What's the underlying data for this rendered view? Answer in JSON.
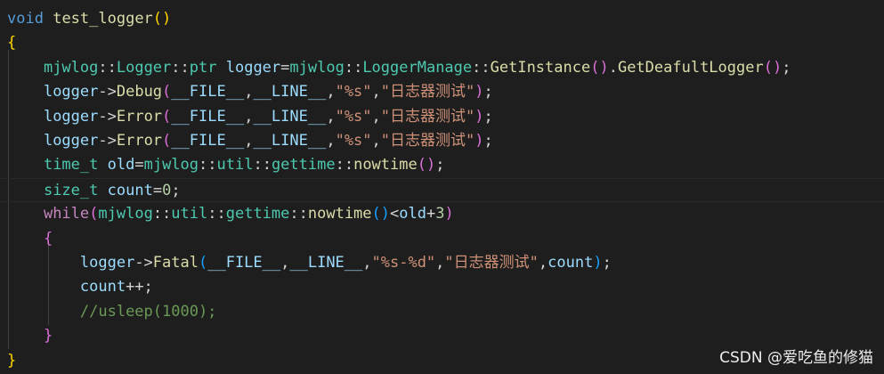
{
  "editor": {
    "colors": {
      "background": "#1e1e1e",
      "keyword": "#569cd6",
      "function": "#dcdcaa",
      "type": "#4ec9b0",
      "variable": "#9cdcfe",
      "string": "#ce9178",
      "number": "#b5cea8",
      "comment": "#6a9955",
      "control": "#c586c0",
      "bracket1": "#ffd700",
      "bracket2": "#da70d6",
      "bracket3": "#179fff",
      "default": "#d4d4d4"
    },
    "lines": [
      [
        [
          "void",
          "keyword"
        ],
        [
          " ",
          "default"
        ],
        [
          "test_logger",
          "function"
        ],
        [
          "()",
          "bracket1"
        ]
      ],
      [
        [
          "{",
          "bracket1"
        ]
      ],
      [
        [
          "    ",
          "default"
        ],
        [
          "mjwlog",
          "type"
        ],
        [
          "::",
          "default"
        ],
        [
          "Logger",
          "type"
        ],
        [
          "::",
          "default"
        ],
        [
          "ptr",
          "type"
        ],
        [
          " ",
          "default"
        ],
        [
          "logger",
          "variable"
        ],
        [
          "=",
          "default"
        ],
        [
          "mjwlog",
          "type"
        ],
        [
          "::",
          "default"
        ],
        [
          "LoggerManage",
          "type"
        ],
        [
          "::",
          "default"
        ],
        [
          "GetInstance",
          "function"
        ],
        [
          "()",
          "bracket2"
        ],
        [
          ".",
          "default"
        ],
        [
          "GetDeafultLogger",
          "function"
        ],
        [
          "()",
          "bracket2"
        ],
        [
          ";",
          "default"
        ]
      ],
      [
        [
          "    ",
          "default"
        ],
        [
          "logger",
          "variable"
        ],
        [
          "->",
          "default"
        ],
        [
          "Debug",
          "function"
        ],
        [
          "(",
          "bracket2"
        ],
        [
          "__FILE__",
          "variable"
        ],
        [
          ",",
          "default"
        ],
        [
          "__LINE__",
          "variable"
        ],
        [
          ",",
          "default"
        ],
        [
          "\"%s\"",
          "string"
        ],
        [
          ",",
          "default"
        ],
        [
          "\"日志器测试\"",
          "string"
        ],
        [
          ")",
          "bracket2"
        ],
        [
          ";",
          "default"
        ]
      ],
      [
        [
          "    ",
          "default"
        ],
        [
          "logger",
          "variable"
        ],
        [
          "->",
          "default"
        ],
        [
          "Error",
          "function"
        ],
        [
          "(",
          "bracket2"
        ],
        [
          "__FILE__",
          "variable"
        ],
        [
          ",",
          "default"
        ],
        [
          "__LINE__",
          "variable"
        ],
        [
          ",",
          "default"
        ],
        [
          "\"%s\"",
          "string"
        ],
        [
          ",",
          "default"
        ],
        [
          "\"日志器测试\"",
          "string"
        ],
        [
          ")",
          "bracket2"
        ],
        [
          ";",
          "default"
        ]
      ],
      [
        [
          "    ",
          "default"
        ],
        [
          "logger",
          "variable"
        ],
        [
          "->",
          "default"
        ],
        [
          "Error",
          "function"
        ],
        [
          "(",
          "bracket2"
        ],
        [
          "__FILE__",
          "variable"
        ],
        [
          ",",
          "default"
        ],
        [
          "__LINE__",
          "variable"
        ],
        [
          ",",
          "default"
        ],
        [
          "\"%s\"",
          "string"
        ],
        [
          ",",
          "default"
        ],
        [
          "\"日志器测试\"",
          "string"
        ],
        [
          ")",
          "bracket2"
        ],
        [
          ";",
          "default"
        ]
      ],
      [
        [
          "    ",
          "default"
        ],
        [
          "time_t",
          "type"
        ],
        [
          " ",
          "default"
        ],
        [
          "old",
          "variable"
        ],
        [
          "=",
          "default"
        ],
        [
          "mjwlog",
          "type"
        ],
        [
          "::",
          "default"
        ],
        [
          "util",
          "type"
        ],
        [
          "::",
          "default"
        ],
        [
          "gettime",
          "type"
        ],
        [
          "::",
          "default"
        ],
        [
          "nowtime",
          "function"
        ],
        [
          "()",
          "bracket2"
        ],
        [
          ";",
          "default"
        ]
      ],
      [
        [
          "    ",
          "default"
        ],
        [
          "size_t",
          "type"
        ],
        [
          " ",
          "default"
        ],
        [
          "count",
          "variable"
        ],
        [
          "=",
          "default"
        ],
        [
          "0",
          "number"
        ],
        [
          ";",
          "default"
        ]
      ],
      [
        [
          "    ",
          "default"
        ],
        [
          "while",
          "control"
        ],
        [
          "(",
          "bracket2"
        ],
        [
          "mjwlog",
          "type"
        ],
        [
          "::",
          "default"
        ],
        [
          "util",
          "type"
        ],
        [
          "::",
          "default"
        ],
        [
          "gettime",
          "type"
        ],
        [
          "::",
          "default"
        ],
        [
          "nowtime",
          "function"
        ],
        [
          "()",
          "bracket3"
        ],
        [
          "<",
          "default"
        ],
        [
          "old",
          "variable"
        ],
        [
          "+",
          "default"
        ],
        [
          "3",
          "number"
        ],
        [
          ")",
          "bracket2"
        ]
      ],
      [
        [
          "    ",
          "default"
        ],
        [
          "{",
          "bracket2"
        ]
      ],
      [
        [
          "        ",
          "default"
        ],
        [
          "logger",
          "variable"
        ],
        [
          "->",
          "default"
        ],
        [
          "Fatal",
          "function"
        ],
        [
          "(",
          "bracket3"
        ],
        [
          "__FILE__",
          "variable"
        ],
        [
          ",",
          "default"
        ],
        [
          "__LINE__",
          "variable"
        ],
        [
          ",",
          "default"
        ],
        [
          "\"%s-%d\"",
          "string"
        ],
        [
          ",",
          "default"
        ],
        [
          "\"日志器测试\"",
          "string"
        ],
        [
          ",",
          "default"
        ],
        [
          "count",
          "variable"
        ],
        [
          ")",
          "bracket3"
        ],
        [
          ";",
          "default"
        ]
      ],
      [
        [
          "        ",
          "default"
        ],
        [
          "count",
          "variable"
        ],
        [
          "++;",
          "default"
        ]
      ],
      [
        [
          "        ",
          "default"
        ],
        [
          "//usleep(1000);",
          "comment"
        ]
      ],
      [
        [
          "    ",
          "default"
        ],
        [
          "}",
          "bracket2"
        ]
      ],
      [
        [
          "}",
          "bracket1"
        ]
      ]
    ]
  },
  "watermark": {
    "text": "CSDN @爱吃鱼的修猫"
  }
}
